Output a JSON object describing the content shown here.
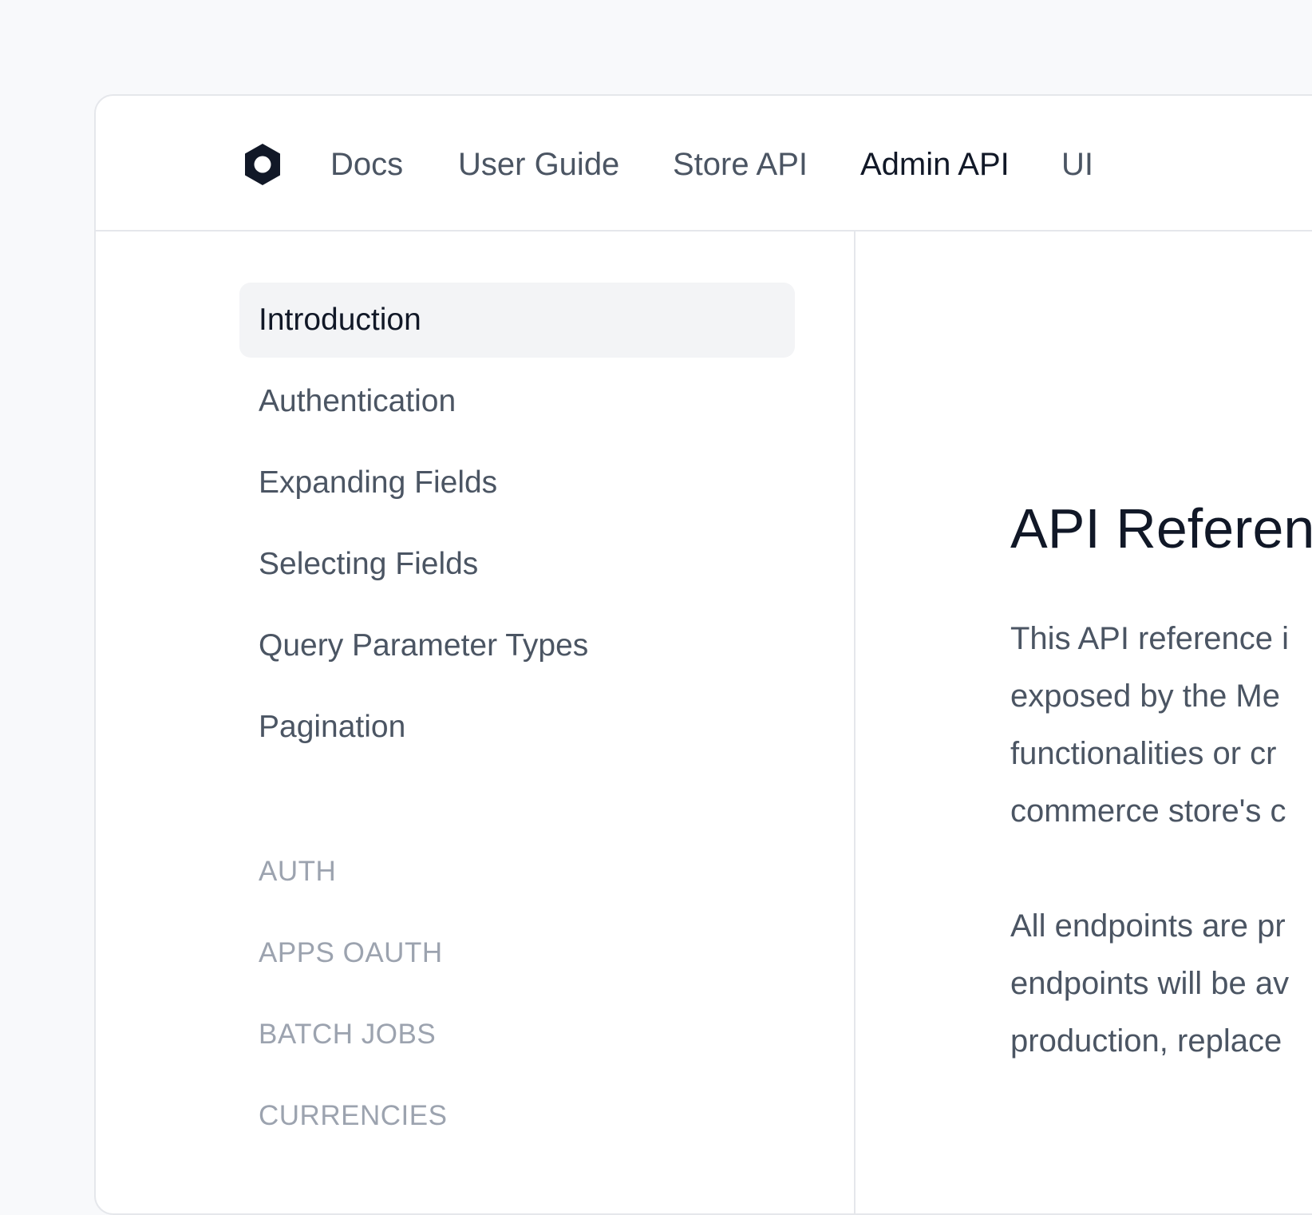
{
  "header": {
    "logo": "medusa-logo-icon",
    "nav": [
      {
        "label": "Docs",
        "active": false
      },
      {
        "label": "User Guide",
        "active": false
      },
      {
        "label": "Store API",
        "active": false
      },
      {
        "label": "Admin API",
        "active": true
      },
      {
        "label": "UI",
        "active": false
      }
    ]
  },
  "sidebar": {
    "items": [
      {
        "label": "Introduction",
        "active": true
      },
      {
        "label": "Authentication",
        "active": false
      },
      {
        "label": "Expanding Fields",
        "active": false
      },
      {
        "label": "Selecting Fields",
        "active": false
      },
      {
        "label": "Query Parameter Types",
        "active": false
      },
      {
        "label": "Pagination",
        "active": false
      }
    ],
    "sections": [
      "AUTH",
      "APPS OAUTH",
      "BATCH JOBS",
      "CURRENCIES"
    ]
  },
  "main": {
    "title": "API Referen",
    "paragraph1": [
      "This API reference i",
      "exposed by the Me",
      "functionalities or cr",
      "commerce store's c"
    ],
    "paragraph2": [
      "All endpoints are pr",
      "endpoints will be av",
      "production, replace"
    ]
  },
  "colors": {
    "background": "#f8f9fb",
    "border": "#e5e7eb",
    "text_primary": "#111827",
    "text_secondary": "#4b5563",
    "text_muted": "#9ca3af",
    "active_bg": "#f3f4f6"
  }
}
